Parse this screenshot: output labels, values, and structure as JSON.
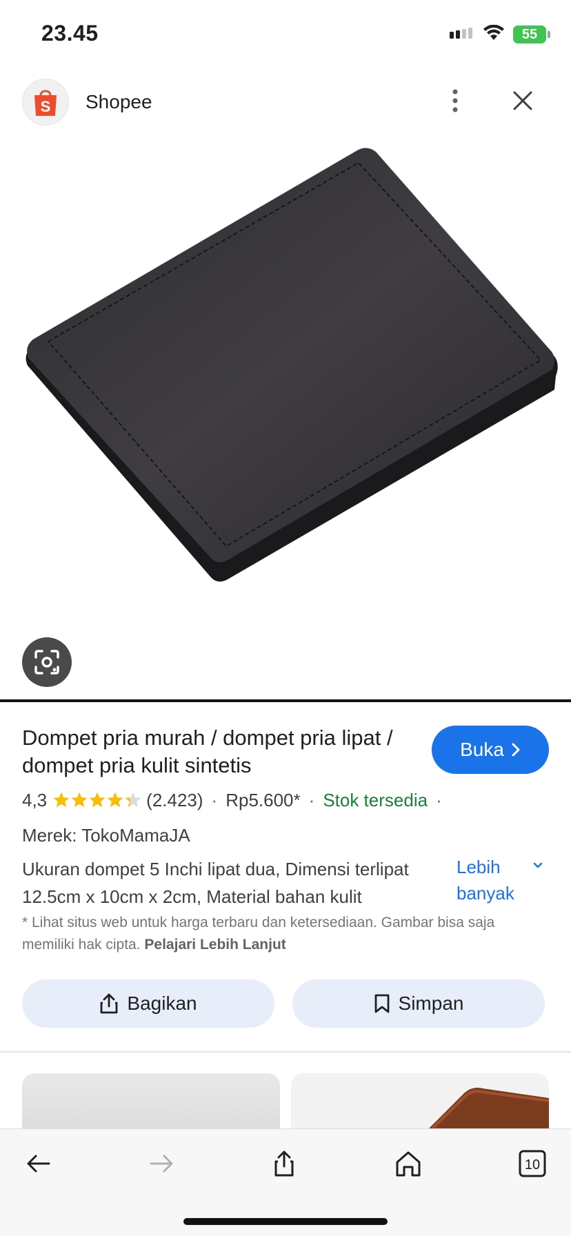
{
  "status_bar": {
    "time": "23.45",
    "battery": "55"
  },
  "header": {
    "site_name": "Shopee",
    "logo_letter": "S",
    "brand_color": "#ee4d2d"
  },
  "product": {
    "title": "Dompet pria murah / dompet pria lipat / dompet pria kulit sintetis",
    "open_label": "Buka",
    "rating": "4,3",
    "rating_value": 4.3,
    "rating_max": 5,
    "reviews": "(2.423)",
    "separator": "·",
    "price": "Rp5.600*",
    "stock": "Stok tersedia",
    "brand": "Merek: TokoMamaJA",
    "description_line1": "Ukuran dompet 5 Inchi lipat dua, Dimensi terlipat",
    "description_line2": "12.5cm x 10cm x 2cm, Material bahan kulit",
    "more_label_1": "Lebih",
    "more_label_2": "banyak",
    "disclaimer": "* Lihat situs web untuk harga terbaru dan ketersediaan. Gambar bisa saja memiliki hak cipta.",
    "learn_more": "Pelajari Lebih Lanjut"
  },
  "actions": {
    "share_label": "Bagikan",
    "save_label": "Simpan"
  },
  "toolbar": {
    "tabs_count": "10"
  },
  "colors": {
    "accent": "#1a73e8",
    "stock_green": "#188038",
    "star": "#fbbc04",
    "pill_bg": "#e8eef9"
  },
  "icons": [
    "cellular-signal-icon",
    "wifi-icon",
    "battery-charging-icon",
    "more-vertical-icon",
    "close-icon",
    "lens-icon",
    "chevron-right-icon",
    "chevron-down-icon",
    "share-icon",
    "bookmark-icon",
    "back-icon",
    "forward-icon",
    "home-icon",
    "tabs-icon"
  ]
}
